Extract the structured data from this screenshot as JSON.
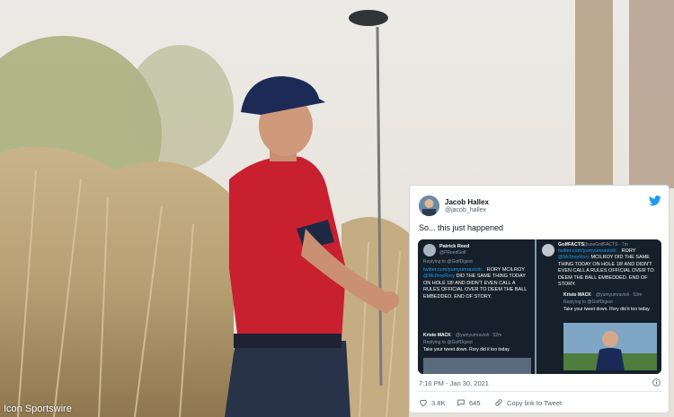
{
  "photo": {
    "credit": "Icon Sportswire",
    "cap_logo": "Titleist",
    "cap_side": "FJ"
  },
  "tweet": {
    "author_name": "Jacob Hallex",
    "author_handle": "@jacob_hallex",
    "text": "So... this just happened",
    "timestamp": "7:16 PM - Jan 30, 2021",
    "likes": "3.8K",
    "replies": "645",
    "share_label": "Copy link to Tweet",
    "colors": {
      "accent": "#1d9bf0",
      "dark_bg": "#15202b"
    },
    "icons": [
      "twitter-bird-icon",
      "info-icon",
      "heart-icon",
      "reply-icon",
      "link-icon"
    ],
    "screenshot": {
      "left": {
        "name": "Patrick Reed",
        "handle": "@PReedGolf",
        "replying": "Replying to @GolfDigest",
        "link": "twitter.com/yumyumravioli/...",
        "mention": "@McIlroyRory",
        "body_a": "RORY MCILROY",
        "body_b": "DID THE SAME THING TODAY ON HOLE 18! AND DIDN'T EVEN CALL A RULES OFFICIAL OVER TO DEEM THE BALL EMBEDDED. END OF STORY.",
        "quoted_name": "Kristo MACK",
        "quoted_handle": "@yumyumravioli · 52m",
        "quoted_replying": "Replying to @GolfDigest",
        "quoted_text": "Take your tweet down. Rory did it too today."
      },
      "right": {
        "name": "GolfFACTS",
        "handle": "@useGolfFACTS · 7m",
        "link": "twitter.com/yumyumravioli/...",
        "mention": "@McIlroyRory",
        "body_a": "RORY",
        "body_b": "MCILROY DID THE SAME THING TODAY ON HOLE 18! AND DIDN'T EVEN CALL A RULES OFFICIAL OVER TO DEEM THE BALL EMBEDDED. END OF STORY.",
        "quoted_name": "Kristo MACK",
        "quoted_handle": "@yumyumravioli · 53m",
        "quoted_replying": "Replying to @GolfDigest",
        "quoted_text": "Take your tweet down. Rory did it too today."
      }
    }
  }
}
